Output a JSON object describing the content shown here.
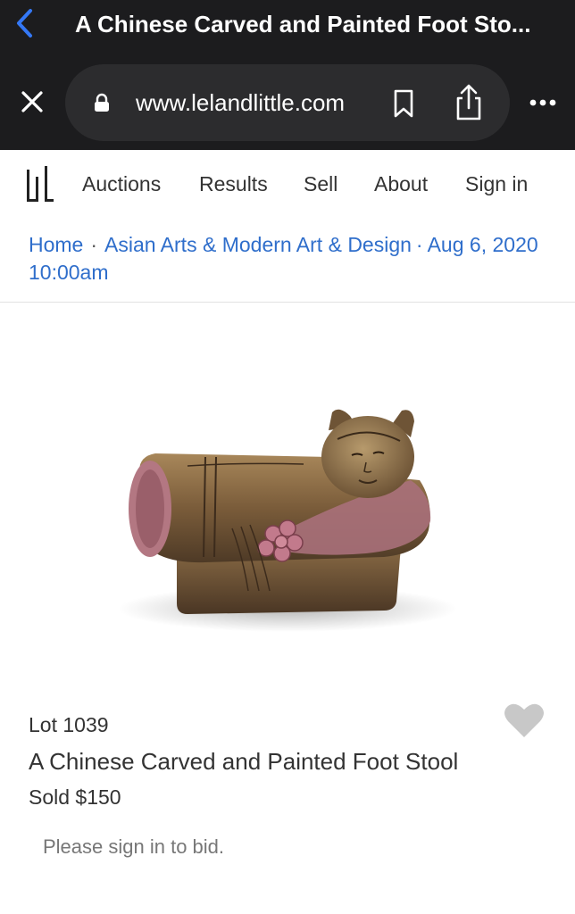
{
  "browser": {
    "title": "A Chinese Carved and Painted Foot Sto...",
    "url": "www.lelandlittle.com"
  },
  "site": {
    "nav": [
      {
        "label": "Auctions"
      },
      {
        "label": "Results"
      },
      {
        "label": "Sell"
      },
      {
        "label": "About"
      },
      {
        "label": "Sign in"
      }
    ]
  },
  "breadcrumb": {
    "home": "Home",
    "sep": "·",
    "sale_title": "Asian Arts & Modern Art & Design",
    "sep2": "·",
    "sale_date": "Aug 6, 2020 10:00am"
  },
  "lot": {
    "number": "Lot 1039",
    "title": "A Chinese Carved and Painted Foot Stool",
    "sold": "Sold $150",
    "note": "Please sign in to bid."
  },
  "colors": {
    "chrome_bg": "#1c1c1e",
    "link": "#2f6ecb",
    "ios_blue": "#3478f6",
    "heart": "#c8c8c8"
  }
}
